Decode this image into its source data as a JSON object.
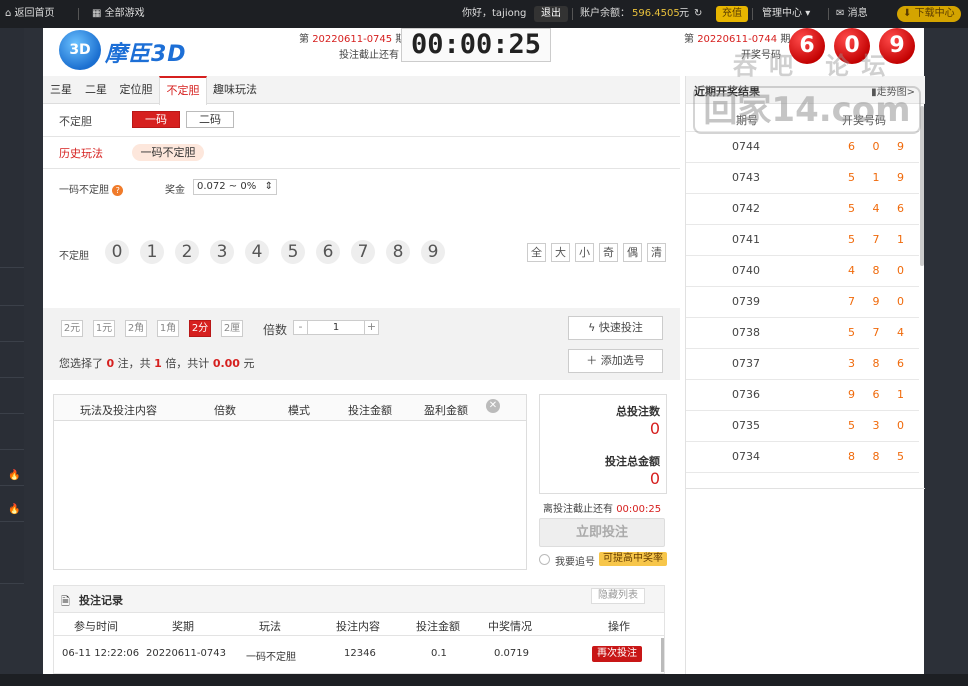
{
  "topbar": {
    "home": "返回首页",
    "all_games": "全部游戏",
    "greeting": "你好，tajiong",
    "logout": "退出",
    "balance_label": "账户余额：",
    "balance_value": "596.4505",
    "balance_unit": "元",
    "recharge": "充值",
    "management": "管理中心",
    "messages": "消息",
    "download": "下载中心"
  },
  "sidebar": {
    "fire_icon": "fire-icon"
  },
  "header": {
    "logo_badge": "3D",
    "logo_name": "摩臣3D",
    "current_issue_prefix": "第",
    "current_issue": "20220611-0745",
    "current_issue_suffix": "期",
    "deadline_label": "投注截止还有",
    "countdown": "00:00:25",
    "last_issue_prefix": "第",
    "last_issue": "20220611-0744",
    "last_issue_suffix": "期",
    "draw_label": "开奖号码",
    "draw_numbers": [
      "6",
      "0",
      "9"
    ]
  },
  "watermark": {
    "line1": "吞吧  论坛",
    "line2": "回家14.com"
  },
  "tabs": [
    "三星",
    "二星",
    "定位胆",
    "不定胆",
    "趣味玩法"
  ],
  "play": {
    "row1_label": "不定胆",
    "one_code": "一码",
    "two_code": "二码",
    "history_label": "历史玩法",
    "history_item": "一码不定胆",
    "play_name": "一码不定胆",
    "prize_label": "奖金",
    "prize_value": "0.072 ~ 0%",
    "ball_label": "不定胆",
    "balls": [
      "0",
      "1",
      "2",
      "3",
      "4",
      "5",
      "6",
      "7",
      "8",
      "9"
    ],
    "quick": [
      "全",
      "大",
      "小",
      "奇",
      "偶",
      "清"
    ]
  },
  "betbar": {
    "modes": [
      "2元",
      "1元",
      "2角",
      "1角",
      "2分",
      "2厘"
    ],
    "multiplier_label": "倍数",
    "multiplier_minus": "-",
    "multiplier_value": "1",
    "multiplier_plus": "+",
    "quick_bet": "快速投注",
    "add_selection": "添加选号",
    "summary_prefix": "您选择了",
    "summary_bets": "0",
    "summary_mid1": "注，共",
    "summary_times": "1",
    "summary_mid2": "倍，共计",
    "summary_amount": "0.00",
    "summary_unit": "元"
  },
  "bet_table": {
    "headers": [
      "玩法及投注内容",
      "倍数",
      "模式",
      "投注金额",
      "盈利金额"
    ]
  },
  "totals": {
    "total_bets_label": "总投注数",
    "total_bets_value": "0",
    "total_amount_label": "投注总金额",
    "total_amount_value": "0",
    "deadline_label": "离投注截止还有",
    "deadline_value": "00:00:25",
    "bet_now": "立即投注",
    "chase_label": "我要追号",
    "chase_tip": "可提高中奖率"
  },
  "records": {
    "title": "投注记录",
    "hide": "隐藏列表",
    "headers": [
      "参与时间",
      "奖期",
      "玩法",
      "投注内容",
      "投注金额",
      "中奖情况",
      "操作"
    ],
    "rows": [
      [
        "06-11 12:22:06",
        "20220611-0743",
        "一码不定胆",
        "12346",
        "0.1",
        "0.0719",
        "再次投注"
      ]
    ]
  },
  "results": {
    "title": "近期开奖结果",
    "trend": "走势图>",
    "col_issue": "期号",
    "col_numbers": "开奖号码",
    "rows": [
      [
        "0744",
        "6 0 9"
      ],
      [
        "0743",
        "5 1 9"
      ],
      [
        "0742",
        "5 4 6"
      ],
      [
        "0741",
        "5 7 1"
      ],
      [
        "0740",
        "4 8 0"
      ],
      [
        "0739",
        "7 9 0"
      ],
      [
        "0738",
        "5 7 4"
      ],
      [
        "0737",
        "3 8 6"
      ],
      [
        "0736",
        "9 6 1"
      ],
      [
        "0735",
        "5 3 0"
      ],
      [
        "0734",
        "8 8 5"
      ]
    ]
  }
}
